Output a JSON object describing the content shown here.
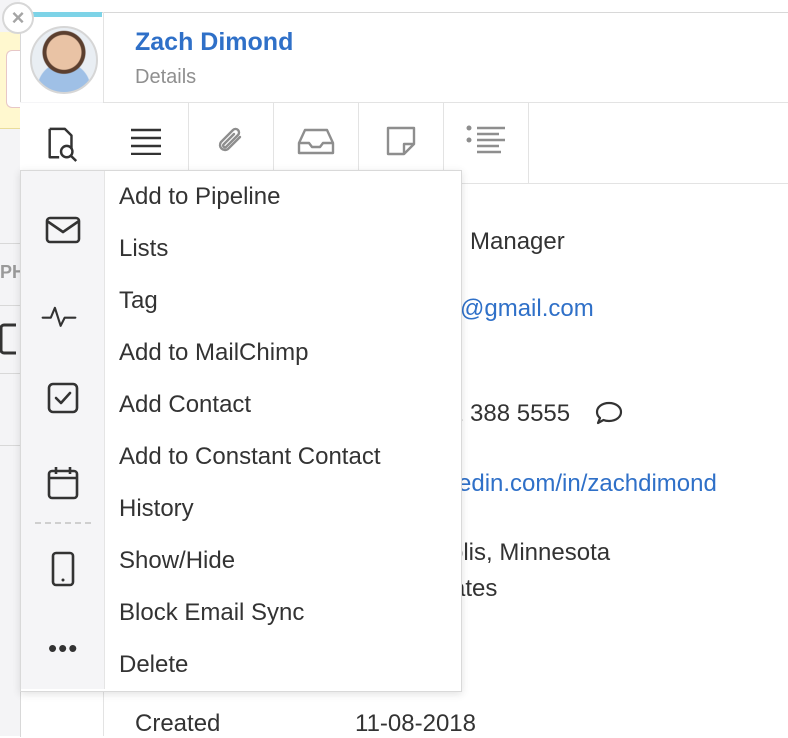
{
  "contact": {
    "name": "Zach Dimond",
    "subtitle": "Details"
  },
  "background": {
    "section_label": "PH"
  },
  "toolbar": {
    "items": [
      {
        "icon": "document-search-icon"
      },
      {
        "icon": "menu-lines-icon"
      },
      {
        "icon": "paperclip-icon"
      },
      {
        "icon": "inbox-icon"
      },
      {
        "icon": "note-icon"
      },
      {
        "icon": "list-bullets-icon"
      }
    ]
  },
  "sidebar": {
    "icons": [
      "mail-icon",
      "activity-icon",
      "checkbox-icon",
      "calendar-icon",
      "mobile-icon"
    ],
    "more_label": "•••"
  },
  "menu": {
    "items": [
      "Add to Pipeline",
      "Lists",
      "Tag",
      "Add to MailChimp",
      "Add Contact",
      "Add to Constant Contact",
      "History",
      "Show/Hide",
      "Block Email Sync",
      "Delete"
    ]
  },
  "details": {
    "title_partial": "g Manager",
    "email_partial": "@gmail.com",
    "phone_partial": "2 388 5555",
    "linkedin_partial": "edin.com/in/zachdimond",
    "location_line1_partial": "olis, Minnesota",
    "location_line2_partial": "ates",
    "created_label": "Created",
    "created_value": "11-08-2018"
  },
  "colors": {
    "accent_blue": "#2f70c8",
    "accent_cyan": "#7dd3e7"
  }
}
